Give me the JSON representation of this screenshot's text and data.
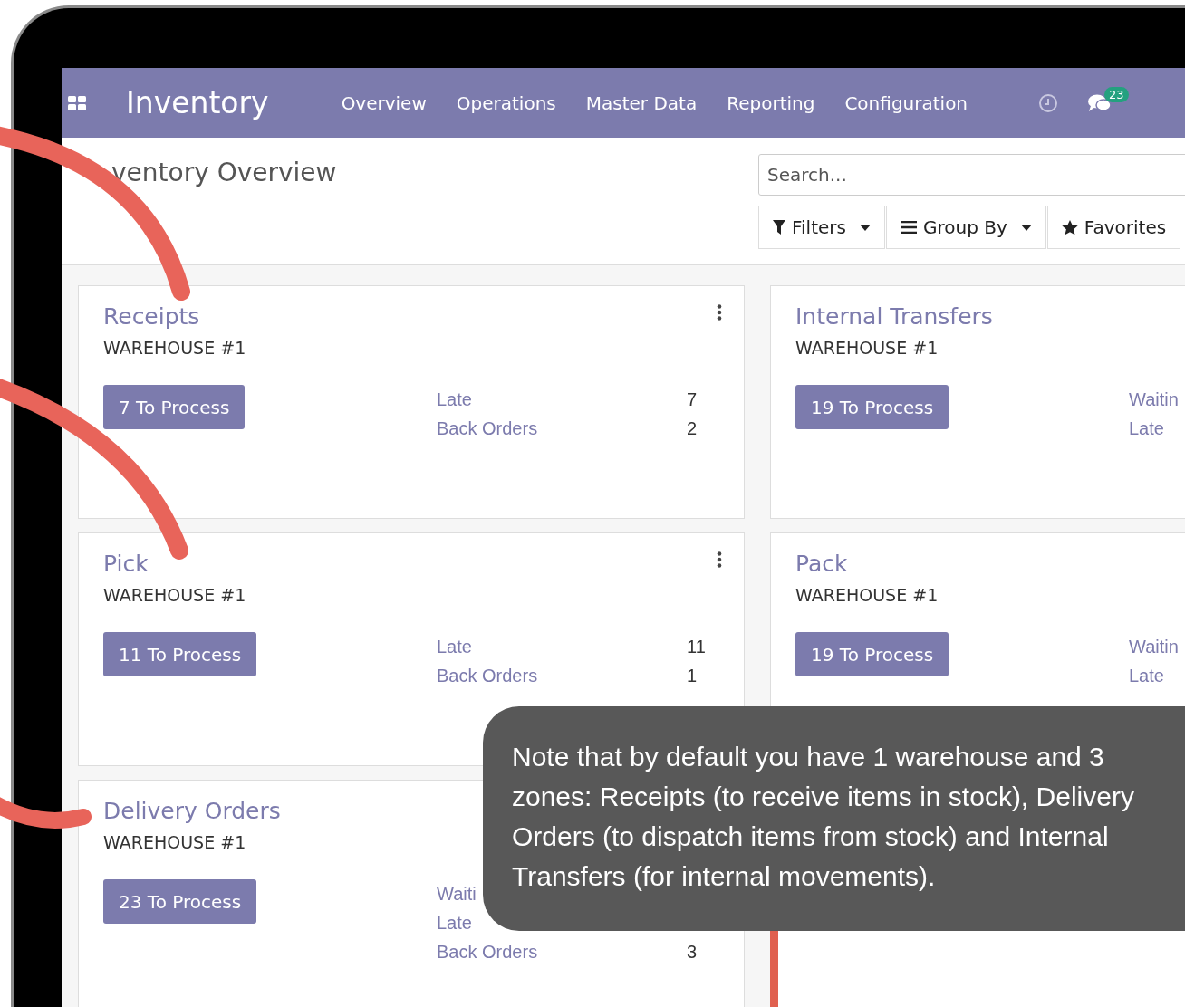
{
  "app": {
    "name": "Inventory",
    "menu": [
      "Overview",
      "Operations",
      "Master Data",
      "Reporting",
      "Configuration"
    ],
    "notification_count": "23"
  },
  "page": {
    "title": "ventory Overview",
    "search": {
      "placeholder": "Search..."
    },
    "buttons": [
      {
        "kind": "filter",
        "label": "Filters"
      },
      {
        "kind": "group",
        "label": "Group By"
      },
      {
        "kind": "favorite",
        "label": "Favorites"
      }
    ]
  },
  "cards": [
    {
      "title": "Receipts",
      "subtitle": "WAREHOUSE #1",
      "button": "7 To Process",
      "menu_icon": true,
      "stats": [
        {
          "label": "Late",
          "value": "7"
        },
        {
          "label": "Back Orders",
          "value": "2"
        }
      ]
    },
    {
      "title": "Internal Transfers",
      "subtitle": "WAREHOUSE #1",
      "button": "19 To Process",
      "menu_icon": false,
      "stats": [
        {
          "label": "Waitin"
        },
        {
          "label": "Late"
        }
      ]
    },
    {
      "title": "Pick",
      "subtitle": "WAREHOUSE #1",
      "button": "11 To Process",
      "menu_icon": true,
      "stats": [
        {
          "label": "Late",
          "value": "11"
        },
        {
          "label": "Back Orders",
          "value": "1"
        }
      ]
    },
    {
      "title": "Pack",
      "subtitle": "WAREHOUSE #1",
      "button": "19 To Process",
      "menu_icon": false,
      "stats": [
        {
          "label": "Waitin"
        },
        {
          "label": "Late"
        }
      ]
    },
    {
      "title": "Delivery Orders",
      "subtitle": "WAREHOUSE #1",
      "button": "23 To Process",
      "menu_icon": false,
      "stats": [
        {
          "label": "Waiti"
        },
        {
          "label": "Late"
        },
        {
          "label": "Back Orders",
          "value": "3"
        }
      ]
    }
  ],
  "tooltip": {
    "text": "Note that by default you have 1 warehouse and 3 zones: Receipts (to receive items in stock), Delivery Orders (to dispatch items from stock) and Internal Transfers (for internal movements)."
  }
}
